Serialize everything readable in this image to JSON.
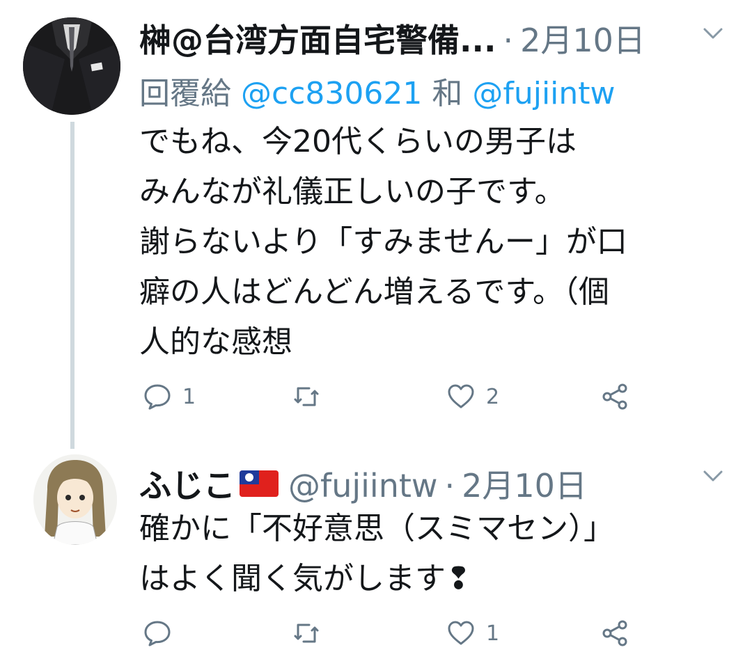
{
  "tweets": [
    {
      "author_name": "榊@台湾方面自宅警備...",
      "author_handle": "",
      "date": "2月10日",
      "reply_prefix": "回覆給",
      "reply_mention_1": "@cc830621",
      "reply_and": "和",
      "reply_mention_2": "@fujiintw",
      "lines": [
        "でもね、今20代くらいの男子は",
        "みんなが礼儀正しいの子です。",
        "謝らないより「すみませんー」が口",
        "癖の人はどんどん増えるです。（個",
        "人的な感想"
      ],
      "reply_count": "1",
      "retweet_count": "",
      "like_count": "2"
    },
    {
      "author_name": "ふじこ",
      "author_handle": "@fujiintw",
      "date": "2月10日",
      "lines": [
        "確かに「不好意思（スミマセン）」",
        "はよく聞く気がします❢"
      ],
      "reply_count": "",
      "retweet_count": "",
      "like_count": "1"
    }
  ],
  "icons": {
    "reply": "reply-icon",
    "retweet": "retweet-icon",
    "like": "heart-icon",
    "share": "share-icon",
    "more": "chevron-down-icon",
    "flag": "taiwan-flag-icon"
  },
  "colors": {
    "text": "#14171a",
    "muted": "#657786",
    "link": "#1da1f2",
    "thread_line": "#cfd9de"
  }
}
